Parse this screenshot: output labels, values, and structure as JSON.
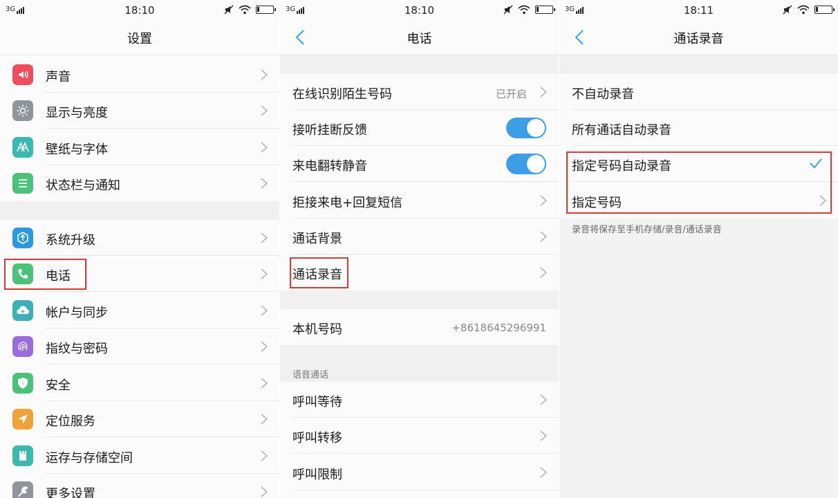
{
  "screens": [
    {
      "status": {
        "network": "3G",
        "time": "18:10"
      },
      "title": "设置",
      "items": [
        {
          "label": "声音",
          "icon": "speaker-icon",
          "color": "#ef4c5e"
        },
        {
          "label": "显示与亮度",
          "icon": "sun-icon",
          "color": "#8f959c"
        },
        {
          "label": "壁纸与字体",
          "icon": "wallpaper-icon",
          "color": "#3cb8b0"
        },
        {
          "label": "状态栏与通知",
          "icon": "list-icon",
          "color": "#4bc17a"
        },
        {
          "label": "系统升级",
          "icon": "upgrade-icon",
          "color": "#2c9ae3"
        },
        {
          "label": "电话",
          "icon": "phone-icon",
          "color": "#4bc17a"
        },
        {
          "label": "帐户与同步",
          "icon": "cloud-sync-icon",
          "color": "#3cb0b8"
        },
        {
          "label": "指纹与密码",
          "icon": "fingerprint-icon",
          "color": "#9a6cdc"
        },
        {
          "label": "安全",
          "icon": "shield-icon",
          "color": "#4bc17a"
        },
        {
          "label": "定位服务",
          "icon": "location-arrow-icon",
          "color": "#f2a23a"
        },
        {
          "label": "运存与存储空间",
          "icon": "storage-card-icon",
          "color": "#3cb8b0"
        },
        {
          "label": "更多设置",
          "icon": "wrench-icon",
          "color": "#8f959c"
        }
      ]
    },
    {
      "status": {
        "network": "3G",
        "time": "18:10"
      },
      "title": "电话",
      "items": [
        {
          "label": "在线识别陌生号码",
          "value": "已开启"
        },
        {
          "label": "接听挂断反馈",
          "toggle": true
        },
        {
          "label": "来电翻转静音",
          "toggle": true
        },
        {
          "label": "拒接来电+回复短信"
        },
        {
          "label": "通话背景"
        },
        {
          "label": "通话录音"
        }
      ],
      "phone_number": {
        "label": "本机号码",
        "value": "+8618645296991"
      },
      "voice_section_title": "语音通话",
      "voice_items": [
        {
          "label": "呼叫等待"
        },
        {
          "label": "呼叫转移"
        },
        {
          "label": "呼叫限制"
        }
      ]
    },
    {
      "status": {
        "network": "3G",
        "time": "18:11"
      },
      "title": "通话录音",
      "options": [
        {
          "label": "不自动录音"
        },
        {
          "label": "所有通话自动录音"
        },
        {
          "label": "指定号码自动录音",
          "selected": true
        },
        {
          "label": "指定号码"
        }
      ],
      "note": "录音将保存至手机存储/录音/通话录音"
    }
  ],
  "colors": {
    "accent": "#3d9ee8",
    "highlight": "#d9383a",
    "divider": "#e6e6e6"
  }
}
